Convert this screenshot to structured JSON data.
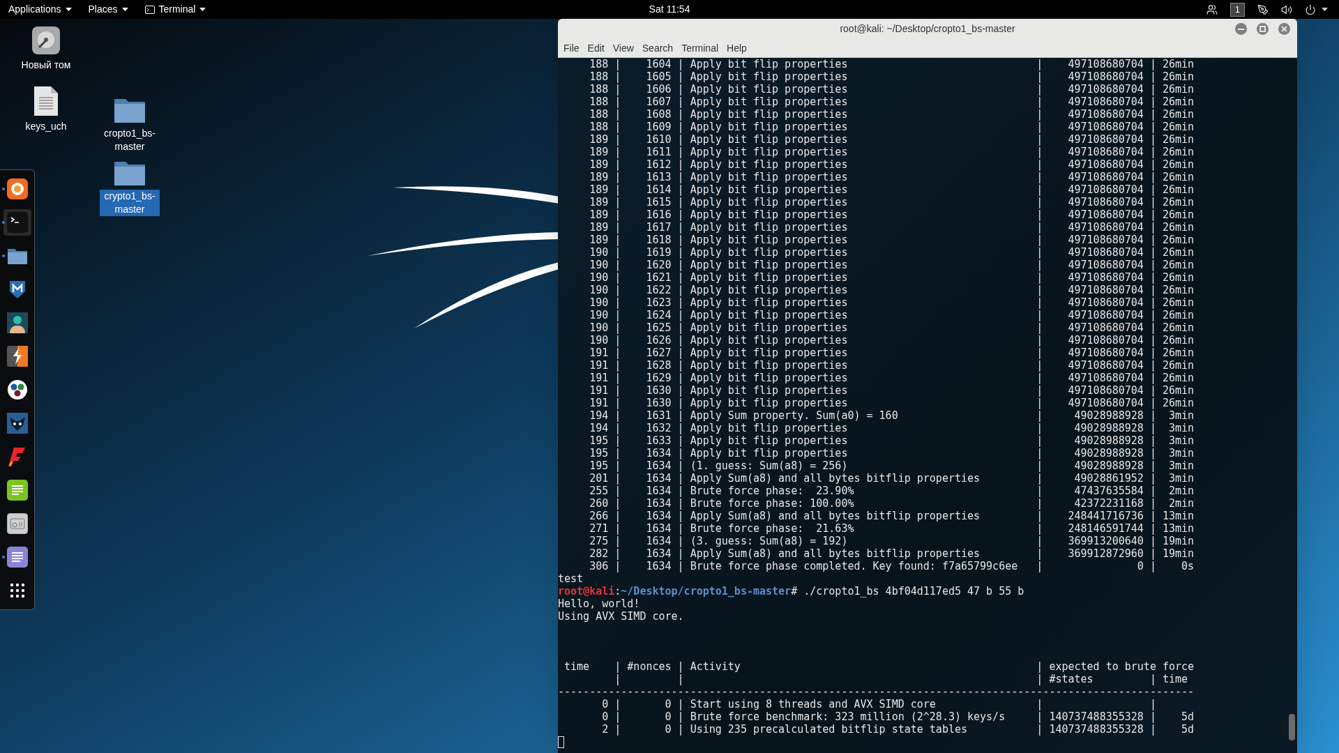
{
  "top_bar": {
    "menus": [
      {
        "label": "Applications",
        "kind": "plain"
      },
      {
        "label": "Places",
        "kind": "plain"
      },
      {
        "label": "Terminal",
        "kind": "terminal"
      }
    ],
    "clock": "Sat 11:54",
    "workspace": "1"
  },
  "desktop_icons": [
    {
      "label": "Новый том",
      "kind": "drive",
      "selected": false
    },
    {
      "label": "keys_uch",
      "kind": "file",
      "selected": false
    },
    {
      "label": "cropto1_bs-master",
      "kind": "folder",
      "selected": false
    },
    {
      "label": "crypto1_bs-master",
      "kind": "folder",
      "selected": true
    }
  ],
  "dock": {
    "apps": [
      {
        "kind": "browser",
        "running": true,
        "selected": false
      },
      {
        "kind": "terminal",
        "running": true,
        "selected": true
      },
      {
        "kind": "folder",
        "running": true,
        "selected": false
      },
      {
        "kind": "shield",
        "running": false,
        "selected": false
      },
      {
        "kind": "person",
        "running": false,
        "selected": false
      },
      {
        "kind": "lightning",
        "running": false,
        "selected": false
      },
      {
        "kind": "dots",
        "running": false,
        "selected": false
      },
      {
        "kind": "emblem",
        "running": false,
        "selected": false
      },
      {
        "kind": "zigzag",
        "running": false,
        "selected": false
      },
      {
        "kind": "notes",
        "running": false,
        "selected": false
      },
      {
        "kind": "radio",
        "running": false,
        "selected": false
      },
      {
        "kind": "document",
        "running": true,
        "selected": false
      },
      {
        "kind": "grid",
        "running": false,
        "selected": false
      }
    ]
  },
  "terminal": {
    "title": "root@kali: ~/Desktop/cropto1_bs-master",
    "menu": [
      "File",
      "Edit",
      "View",
      "Search",
      "Terminal",
      "Help"
    ],
    "lines": [
      {
        "kind": "text",
        "text": "     188 |    1604 | Apply bit flip properties                              |    497108680704 | 26min"
      },
      {
        "kind": "text",
        "text": "     188 |    1605 | Apply bit flip properties                              |    497108680704 | 26min"
      },
      {
        "kind": "text",
        "text": "     188 |    1606 | Apply bit flip properties                              |    497108680704 | 26min"
      },
      {
        "kind": "text",
        "text": "     188 |    1607 | Apply bit flip properties                              |    497108680704 | 26min"
      },
      {
        "kind": "text",
        "text": "     188 |    1608 | Apply bit flip properties                              |    497108680704 | 26min"
      },
      {
        "kind": "text",
        "text": "     188 |    1609 | Apply bit flip properties                              |    497108680704 | 26min"
      },
      {
        "kind": "text",
        "text": "     189 |    1610 | Apply bit flip properties                              |    497108680704 | 26min"
      },
      {
        "kind": "text",
        "text": "     189 |    1611 | Apply bit flip properties                              |    497108680704 | 26min"
      },
      {
        "kind": "text",
        "text": "     189 |    1612 | Apply bit flip properties                              |    497108680704 | 26min"
      },
      {
        "kind": "text",
        "text": "     189 |    1613 | Apply bit flip properties                              |    497108680704 | 26min"
      },
      {
        "kind": "text",
        "text": "     189 |    1614 | Apply bit flip properties                              |    497108680704 | 26min"
      },
      {
        "kind": "text",
        "text": "     189 |    1615 | Apply bit flip properties                              |    497108680704 | 26min"
      },
      {
        "kind": "text",
        "text": "     189 |    1616 | Apply bit flip properties                              |    497108680704 | 26min"
      },
      {
        "kind": "text",
        "text": "     189 |    1617 | Apply bit flip properties                              |    497108680704 | 26min"
      },
      {
        "kind": "text",
        "text": "     189 |    1618 | Apply bit flip properties                              |    497108680704 | 26min"
      },
      {
        "kind": "text",
        "text": "     190 |    1619 | Apply bit flip properties                              |    497108680704 | 26min"
      },
      {
        "kind": "text",
        "text": "     190 |    1620 | Apply bit flip properties                              |    497108680704 | 26min"
      },
      {
        "kind": "text",
        "text": "     190 |    1621 | Apply bit flip properties                              |    497108680704 | 26min"
      },
      {
        "kind": "text",
        "text": "     190 |    1622 | Apply bit flip properties                              |    497108680704 | 26min"
      },
      {
        "kind": "text",
        "text": "     190 |    1623 | Apply bit flip properties                              |    497108680704 | 26min"
      },
      {
        "kind": "text",
        "text": "     190 |    1624 | Apply bit flip properties                              |    497108680704 | 26min"
      },
      {
        "kind": "text",
        "text": "     190 |    1625 | Apply bit flip properties                              |    497108680704 | 26min"
      },
      {
        "kind": "text",
        "text": "     190 |    1626 | Apply bit flip properties                              |    497108680704 | 26min"
      },
      {
        "kind": "text",
        "text": "     191 |    1627 | Apply bit flip properties                              |    497108680704 | 26min"
      },
      {
        "kind": "text",
        "text": "     191 |    1628 | Apply bit flip properties                              |    497108680704 | 26min"
      },
      {
        "kind": "text",
        "text": "     191 |    1629 | Apply bit flip properties                              |    497108680704 | 26min"
      },
      {
        "kind": "text",
        "text": "     191 |    1630 | Apply bit flip properties                              |    497108680704 | 26min"
      },
      {
        "kind": "text",
        "text": "     191 |    1630 | Apply bit flip properties                              |    497108680704 | 26min"
      },
      {
        "kind": "text",
        "text": "     194 |    1631 | Apply Sum property. Sum(a0) = 160                      |     49028988928 |  3min"
      },
      {
        "kind": "text",
        "text": "     194 |    1632 | Apply bit flip properties                              |     49028988928 |  3min"
      },
      {
        "kind": "text",
        "text": "     195 |    1633 | Apply bit flip properties                              |     49028988928 |  3min"
      },
      {
        "kind": "text",
        "text": "     195 |    1634 | Apply bit flip properties                              |     49028988928 |  3min"
      },
      {
        "kind": "text",
        "text": "     195 |    1634 | (1. guess: Sum(a8) = 256)                              |     49028988928 |  3min"
      },
      {
        "kind": "text",
        "text": "     201 |    1634 | Apply Sum(a8) and all bytes bitflip properties         |     49028861952 |  3min"
      },
      {
        "kind": "text",
        "text": "     255 |    1634 | Brute force phase:  23.90%                             |     47437635584 |  2min"
      },
      {
        "kind": "text",
        "text": "     260 |    1634 | Brute force phase: 100.00%                             |     42372231168 |  2min"
      },
      {
        "kind": "text",
        "text": "     266 |    1634 | Apply Sum(a8) and all bytes bitflip properties         |    248441716736 | 13min"
      },
      {
        "kind": "text",
        "text": "     271 |    1634 | Brute force phase:  21.63%                             |    248146591744 | 13min"
      },
      {
        "kind": "text",
        "text": "     275 |    1634 | (3. guess: Sum(a8) = 192)                              |    369913200640 | 19min"
      },
      {
        "kind": "text",
        "text": "     282 |    1634 | Apply Sum(a8) and all bytes bitflip properties         |    369912872960 | 19min"
      },
      {
        "kind": "text",
        "text": "     306 |    1634 | Brute force phase completed. Key found: f7a65799c6ee   |               0 |    0s"
      },
      {
        "kind": "text",
        "text": "test"
      },
      {
        "kind": "prompt",
        "user": "root@kali",
        "separator": ":",
        "path": "~/Desktop/cropto1_bs-master",
        "command": "# ./cropto1_bs 4bf04d117ed5 47 b 55 b"
      },
      {
        "kind": "text",
        "text": "Hello, world!"
      },
      {
        "kind": "text",
        "text": "Using AVX SIMD core."
      },
      {
        "kind": "blank"
      },
      {
        "kind": "blank"
      },
      {
        "kind": "blank"
      },
      {
        "kind": "text",
        "text": " time    | #nonces | Activity                                               | expected to brute force"
      },
      {
        "kind": "text",
        "text": "         |         |                                                        | #states         | time"
      },
      {
        "kind": "text",
        "text": "-----------------------------------------------------------------------------------------------------"
      },
      {
        "kind": "text",
        "text": "       0 |       0 | Start using 8 threads and AVX SIMD core                |                 |"
      },
      {
        "kind": "text",
        "text": "       0 |       0 | Brute force benchmark: 323 million (2^28.3) keys/s     | 140737488355328 |    5d"
      },
      {
        "kind": "text",
        "text": "       2 |       0 | Using 235 precalculated bitflip state tables           | 140737488355328 |    5d"
      },
      {
        "kind": "cursor"
      }
    ]
  }
}
